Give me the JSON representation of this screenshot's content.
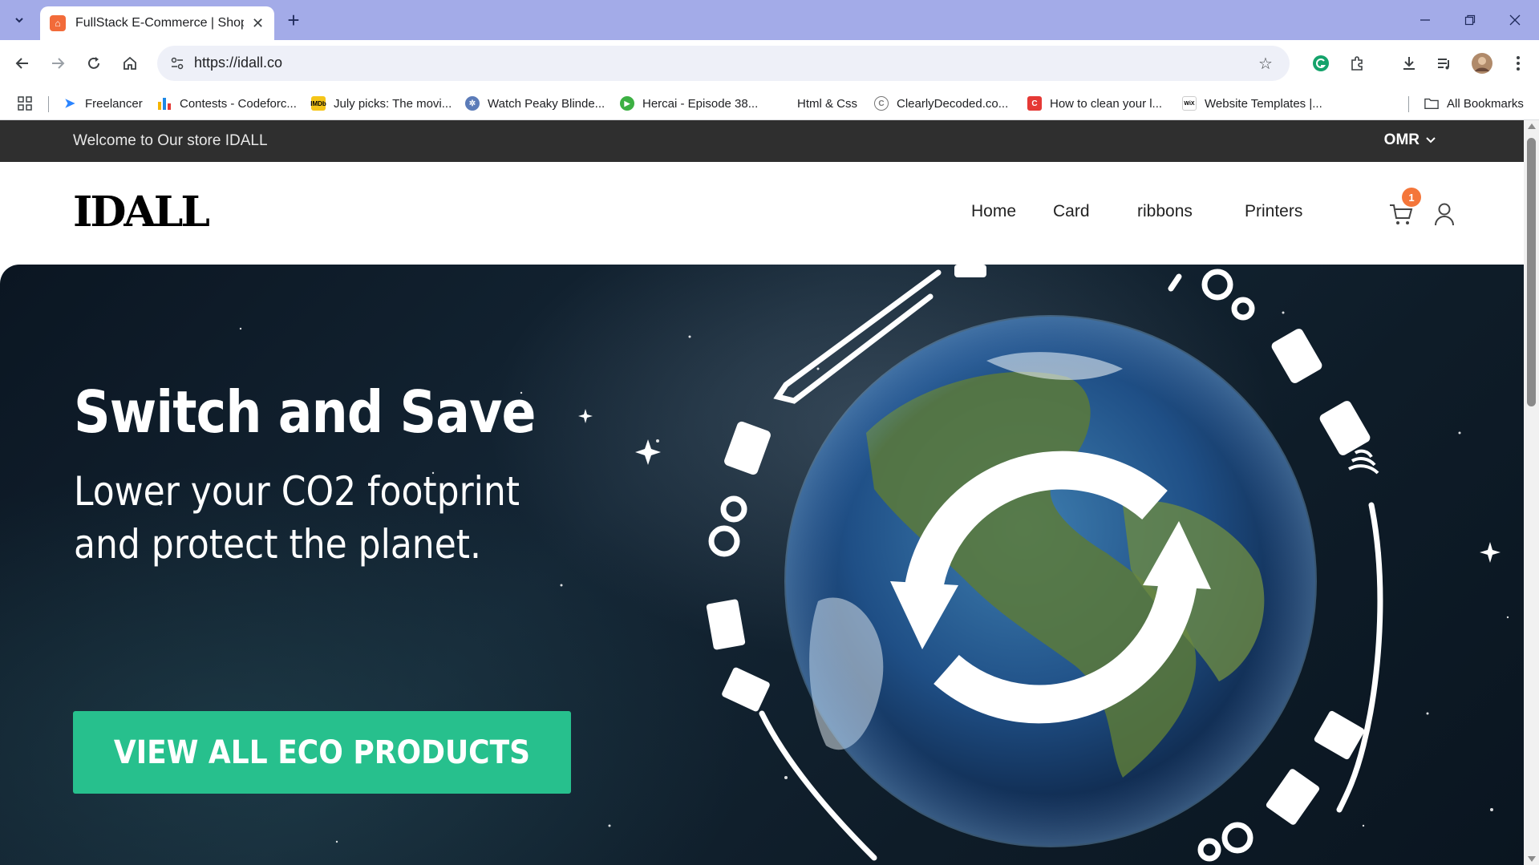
{
  "browser": {
    "tab": {
      "title": "FullStack E-Commerce | Shop U",
      "favicon_icon": "store-favicon-icon"
    },
    "url": "https://idall.co",
    "bookmarks": [
      {
        "label": "Freelancer",
        "icon": "freelancer-icon",
        "color": "#2a84ff"
      },
      {
        "label": "Contests - Codeforc...",
        "icon": "codeforces-icon",
        "color": "#f5b400"
      },
      {
        "label": "July picks: The movi...",
        "icon": "imdb-icon",
        "color": "#f5c518"
      },
      {
        "label": "Watch Peaky Blinde...",
        "icon": "movie-site-icon",
        "color": "#5b7bb8"
      },
      {
        "label": "Hercai - Episode 38...",
        "icon": "play-icon",
        "color": "#3cb043"
      },
      {
        "label": "Html & Css",
        "icon": "",
        "color": ""
      },
      {
        "label": "ClearlyDecoded.co...",
        "icon": "clearlydecoded-icon",
        "color": "#777777"
      },
      {
        "label": "How to clean your l...",
        "icon": "cleaning-site-icon",
        "color": "#e53935"
      },
      {
        "label": "Website Templates |...",
        "icon": "wix-icon",
        "color": "#333333"
      }
    ],
    "all_bookmarks": "All Bookmarks"
  },
  "page": {
    "announcement": "Welcome to Our store IDALL",
    "currency": "OMR",
    "logo_text": "IDALL",
    "nav": [
      "Home",
      "Card",
      "ribbons",
      "Printers"
    ],
    "cart_count": "1",
    "hero": {
      "title": "Switch and Save",
      "subtitle_line1": "Lower your CO2 footprint",
      "subtitle_line2": "and protect the planet.",
      "cta": "VIEW ALL ECO PRODUCTS"
    }
  },
  "colors": {
    "titlebar": "#a3abe8",
    "announcement_bg": "#2f2f2f",
    "cta_green": "#27c08d",
    "badge_orange": "#f4763a"
  }
}
